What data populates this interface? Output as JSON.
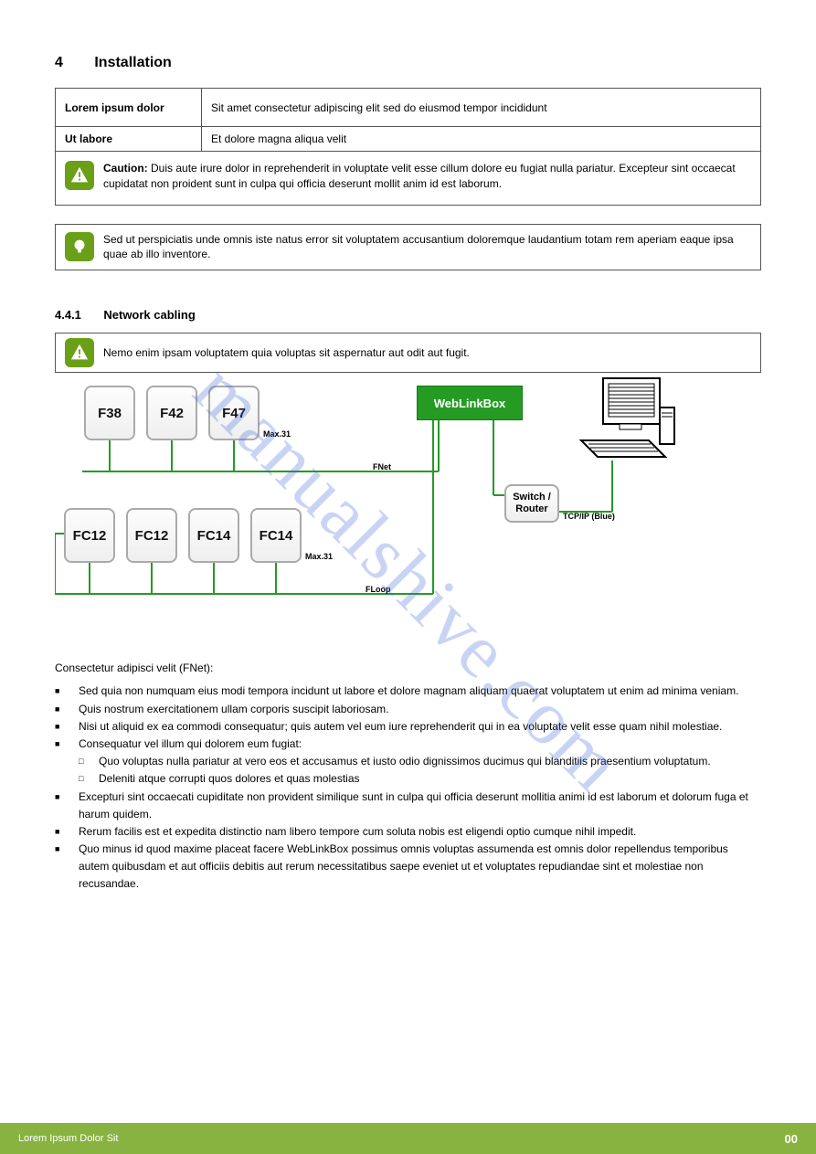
{
  "section": {
    "num": "4",
    "title": "Installation"
  },
  "table": {
    "r1_left": "Lorem ipsum dolor",
    "r1_right": "Sit amet consectetur adipiscing elit sed do eiusmod tempor incididunt",
    "r2_left": "Ut labore",
    "r2_right": "Et dolore magna aliqua velit"
  },
  "caution": {
    "bold": "Caution:",
    "text": " Duis aute irure dolor in reprehenderit in voluptate velit esse cillum dolore eu fugiat nulla pariatur. Excepteur sint occaecat cupidatat non proident sunt in culpa qui officia deserunt mollit anim id est laborum."
  },
  "tip": {
    "text": "Sed ut perspiciatis unde omnis iste natus error sit voluptatem accusantium doloremque laudantium totam rem aperiam eaque ipsa quae ab illo inventore."
  },
  "subsection": {
    "num": "4.4.1",
    "title": "Network cabling"
  },
  "warn_bar": {
    "text": "Nemo enim ipsam voluptatem quia voluptas sit aspernatur aut odit aut fugit."
  },
  "diagram": {
    "top_nodes": [
      "F38",
      "F42",
      "F47"
    ],
    "bottom_nodes": [
      "FC12",
      "FC12",
      "FC14",
      "FC14"
    ],
    "weblink": "WebLinkBox",
    "switch_l1": "Switch /",
    "switch_l2": "Router",
    "max_top": "Max.31",
    "max_bottom": "Max.31",
    "fnet": "FNet",
    "floop": "FLoop",
    "tcp": "TCP/IP (Blue)"
  },
  "fnet_list": {
    "heading": "Consectetur adipisci velit (FNet):",
    "i1": "Sed quia non numquam eius modi tempora incidunt ut labore et dolore magnam aliquam quaerat voluptatem ut enim ad minima veniam.",
    "i2": "Quis nostrum exercitationem ullam corporis suscipit laboriosam.",
    "i3": "Nisi ut aliquid ex ea commodi consequatur; quis autem vel eum iure reprehenderit qui in ea voluptate velit esse quam nihil molestiae.",
    "i4": "Consequatur vel illum qui dolorem eum fugiat:",
    "n1": "Quo voluptas nulla pariatur at vero eos et accusamus et iusto odio dignissimos ducimus qui blanditiis praesentium voluptatum.",
    "n2": "Deleniti atque corrupti quos dolores et quas molestias",
    "i5": "Excepturi sint occaecati cupiditate non provident similique sunt in culpa qui officia deserunt mollitia animi id est laborum et dolorum fuga et harum quidem.",
    "i6": "Rerum facilis est et expedita distinctio nam libero tempore cum soluta nobis est eligendi optio cumque nihil impedit.",
    "i7": "Quo minus id quod maxime placeat facere WebLinkBox possimus omnis voluptas assumenda est omnis dolor repellendus temporibus autem quibusdam et aut officiis debitis aut rerum necessitatibus saepe eveniet ut et voluptates repudiandae sint et molestiae non recusandae."
  },
  "footer": {
    "left": "Lorem Ipsum Dolor Sit",
    "right": "00"
  },
  "watermark": "manualshive.com"
}
